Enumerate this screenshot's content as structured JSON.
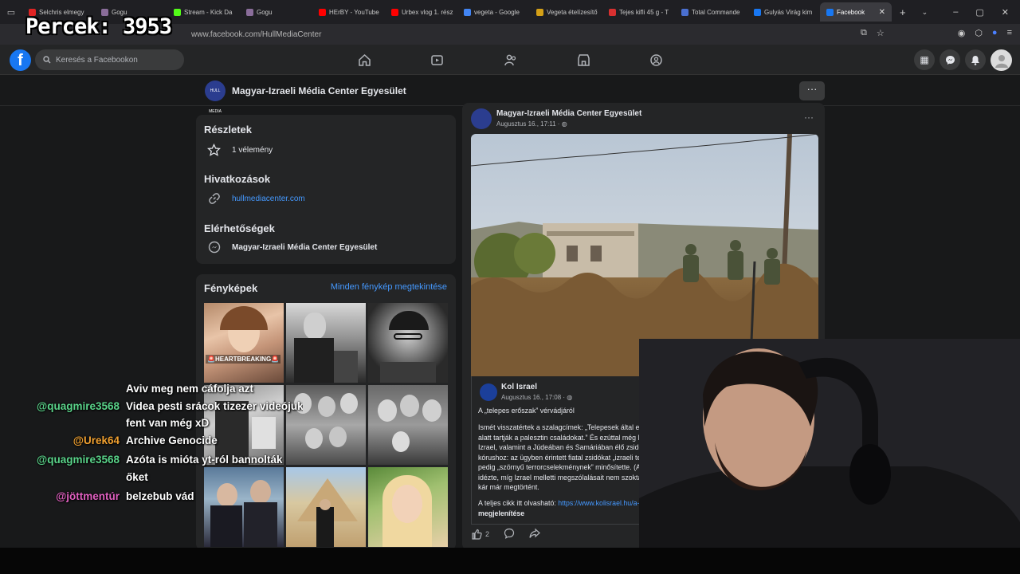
{
  "browser": {
    "tabs": [
      {
        "label": "Selchris elmegy",
        "color": "#e02424"
      },
      {
        "label": "Gogu",
        "color": "#8a6d9a"
      },
      {
        "label": "Stream - Kick Da",
        "color": "#53fc18"
      },
      {
        "label": "Gogu",
        "color": "#8a6d9a"
      },
      {
        "label": "HErBY - YouTube",
        "color": "#ff0000"
      },
      {
        "label": "Urbex vlog 1. rész",
        "color": "#ff0000"
      },
      {
        "label": "vegeta - Google",
        "color": "#4285f4"
      },
      {
        "label": "Vegeta ételízesítő",
        "color": "#d4a017"
      },
      {
        "label": "Tejes kifli 45 g - T",
        "color": "#d83030"
      },
      {
        "label": "Total Commande",
        "color": "#4a6fd0"
      },
      {
        "label": "Gulyás Virág kim",
        "color": "#1877f2"
      },
      {
        "label": "Facebook",
        "color": "#1877f2",
        "active": true
      }
    ],
    "url": "www.facebook.com/HullMediaCenter"
  },
  "facebook": {
    "search_placeholder": "Keresés a Facebookon",
    "nav_icons": [
      "home-icon",
      "video-icon",
      "friends-icon",
      "marketplace-icon",
      "groups-icon"
    ],
    "right_icons": [
      "menu-grid-icon",
      "messenger-icon",
      "notifications-icon",
      "account-avatar"
    ]
  },
  "page": {
    "name": "Magyar-Izraeli Média Center Egyesület",
    "avatar_text": "HULL MEDIA",
    "details": {
      "title": "Részletek",
      "reviews": "1 vélemény",
      "links_title": "Hivatkozások",
      "link": "hullmediacenter.com",
      "contacts_title": "Elérhetőségek",
      "contact": "Magyar-Izraeli Média Center Egyesület"
    },
    "photos": {
      "title": "Fényképek",
      "see_all": "Minden fénykép megtekintése",
      "badge": "🚨HEARTBREAKING🚨"
    }
  },
  "post": {
    "author": "Magyar-Izraeli Média Center Egyesület",
    "date": "Augusztus 16., 17:11 · ",
    "shared_author": "Kol Israel",
    "shared_date": "Augusztus 16., 17:08 · ",
    "shared_title": "A „telepes erőszak” vérvádjáról",
    "shared_body": [
      "Ismét visszatértek a szalagcímek: „Telepesek által elkövetett erő",
      "alatt tartják a palesztin családokat.” És ezúttal még Mike Huck",
      "Izrael, valamint a Júdeában és Samáriában élő zsidók jogainak ő",
      "kórushoz: az ügyben érintett fiatal zsidókat „izraeli terroristáknal",
      "pedig „szörnyű terrorcselekménynek” minősítette. (A magyar s",
      "idézte, míg Izrael melletti megszólalásait nem szokta – a szerk.)",
      "kár már megtörtént."
    ],
    "read_more_prefix": "A teljes cikk itt olvasható: ",
    "read_more_link": "https://www.kolisrael.hu/a-telepe",
    "show_more": "megjelenítése",
    "likes": "2"
  },
  "overlay": {
    "counter": "Percek:  3953",
    "chat": [
      {
        "user": "",
        "text": "Aviv meg nem cáfolja azt",
        "user_color": "#5ad48a"
      },
      {
        "user": "@quagmire3568",
        "text": "Videa pesti srácok tizezer videójuk",
        "user_color": "#5ad48a"
      },
      {
        "user": "",
        "text": "fent van még xD",
        "user_color": "#5ad48a"
      },
      {
        "user": "@Urek64",
        "text": "Archive Genocide",
        "user_color": "#f0a030"
      },
      {
        "user": "@quagmire3568",
        "text": "Azóta is mióta yt-ról bannolták",
        "user_color": "#5ad48a"
      },
      {
        "user": "",
        "text": "őket",
        "user_color": "#5ad48a"
      },
      {
        "user": "@jöttmentúr",
        "text": "belzebub vád",
        "user_color": "#e060c0"
      }
    ]
  }
}
